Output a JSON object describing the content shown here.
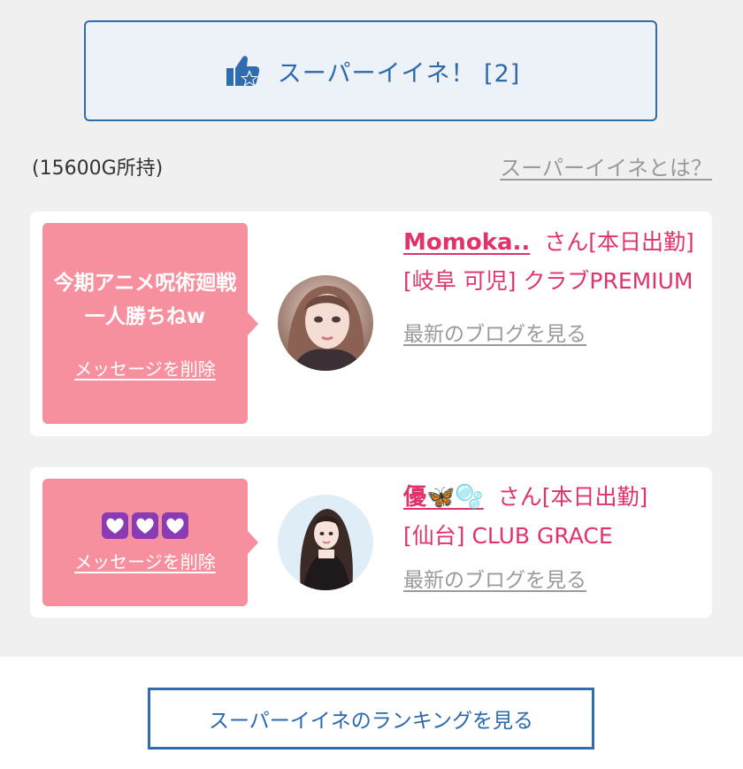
{
  "super_button": {
    "label": "スーパーイイネ！ [2]",
    "icon": "thumbs-up-star-icon"
  },
  "points_label": "(15600G所持)",
  "what_is_link": "スーパーイイネとは？",
  "cards": [
    {
      "message": "今期アニメ呪術廻戦一人勝ちねw",
      "delete_label": "メッセージを削除",
      "name": "Momoka..",
      "suffix": "さん[本日出勤]",
      "shop": "[岐阜 可児] クラブPREMIUM",
      "blog_link": "最新のブログを見る"
    },
    {
      "message_emoji": "💜💜💜",
      "delete_label": "メッセージを削除",
      "name": "優🦋🫧",
      "suffix": "さん[本日出勤]",
      "shop": "[仙台] CLUB GRACE",
      "blog_link": "最新のブログを見る"
    }
  ],
  "ranking_button": "スーパーイイネのランキングを見る",
  "colors": {
    "accent_blue": "#2f6cb0",
    "bubble_pink": "#f6909f",
    "name_pink": "#e0336b",
    "link_gray": "#9a9a9a",
    "background_gray": "#f0f0f0"
  }
}
